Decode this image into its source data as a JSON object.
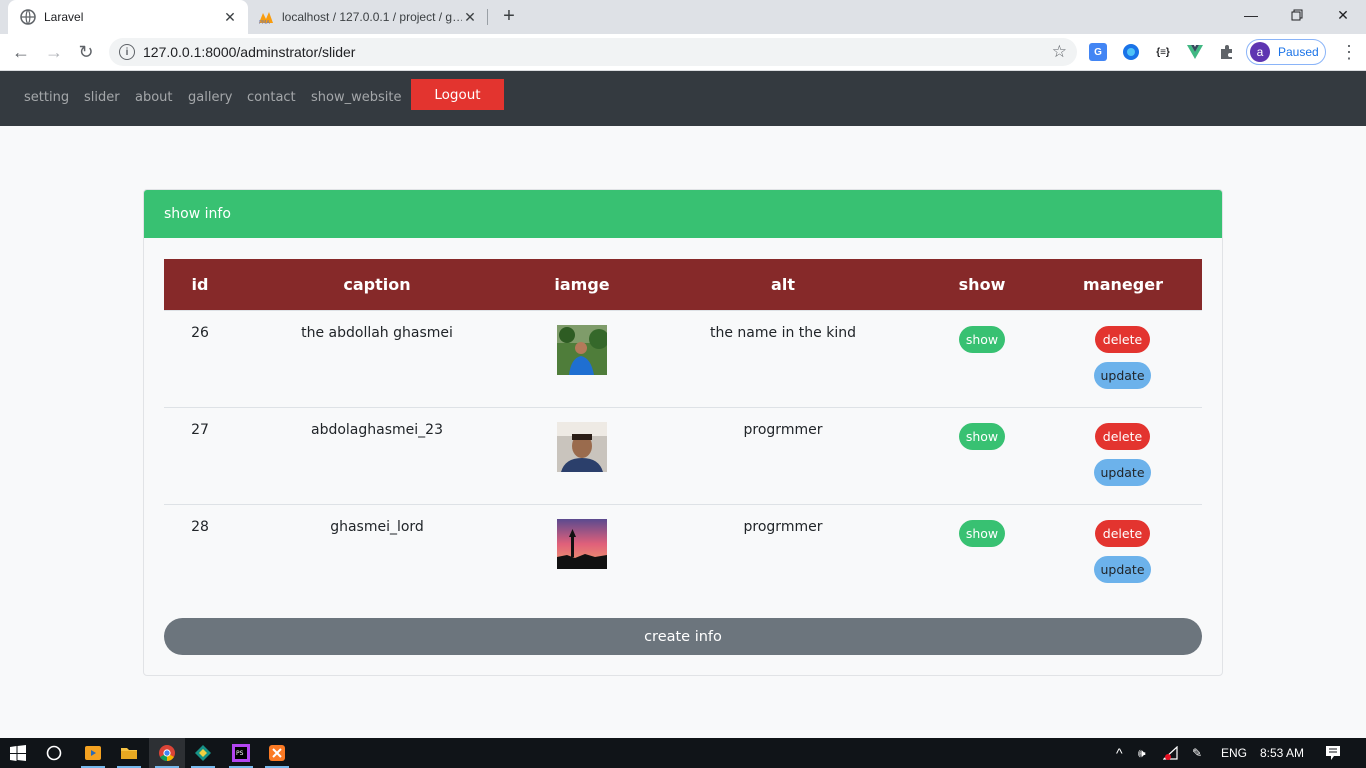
{
  "browser": {
    "tabs": [
      {
        "title": "Laravel",
        "icon": "globe-icon"
      },
      {
        "title": "localhost / 127.0.0.1 / project / g…",
        "icon": "phpmyadmin-icon"
      }
    ],
    "url": "127.0.0.1:8000/adminstrator/slider",
    "profile_initial": "a",
    "profile_status": "Paused"
  },
  "nav": {
    "links": [
      "setting",
      "slider",
      "about",
      "gallery",
      "contact",
      "show_website"
    ],
    "logout_label": "Logout"
  },
  "card": {
    "header": "show info",
    "columns": [
      "id",
      "caption",
      "iamge",
      "alt",
      "show",
      "maneger"
    ],
    "rows": [
      {
        "id": "26",
        "caption": "the abdollah ghasmei",
        "alt": "the name in the kind",
        "show": "show",
        "delete": "delete",
        "update": "update"
      },
      {
        "id": "27",
        "caption": "abdolaghasmei_23",
        "alt": "progrmmer",
        "show": "show",
        "delete": "delete",
        "update": "update"
      },
      {
        "id": "28",
        "caption": "ghasmei_lord",
        "alt": "progrmmer",
        "show": "show",
        "delete": "delete",
        "update": "update"
      }
    ],
    "create_label": "create info"
  },
  "taskbar": {
    "lang": "ENG",
    "time": "8:53 AM"
  },
  "colors": {
    "navbar": "#343a40",
    "header_green": "#38c172",
    "table_head": "#862929",
    "danger": "#e3342f",
    "info": "#6cb2eb",
    "secondary": "#6c757d"
  }
}
